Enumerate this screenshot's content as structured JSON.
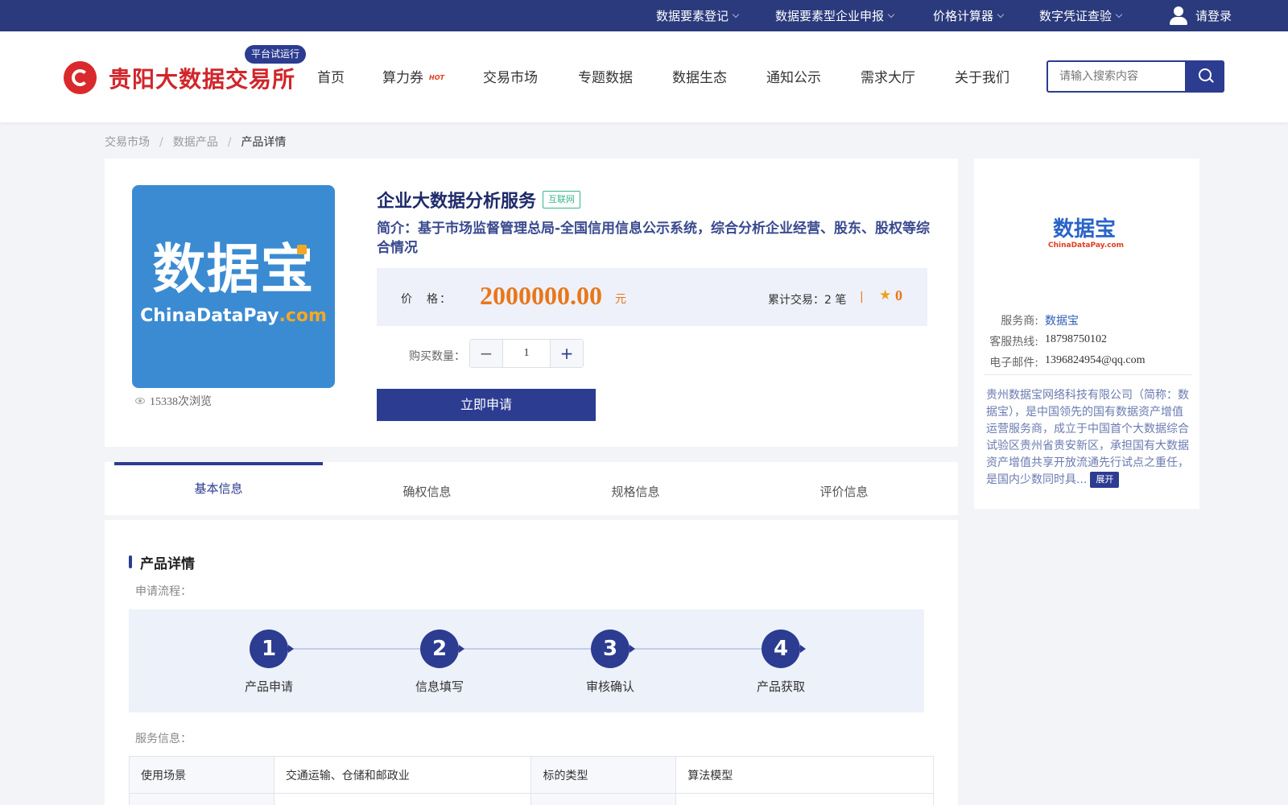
{
  "topbar": {
    "links": [
      "数据要素登记",
      "数据要素型企业申报",
      "价格计算器",
      "数字凭证查验"
    ],
    "login": "请登录"
  },
  "header": {
    "logo_text": "贵阳大数据交易所",
    "beta_badge": "平台试运行",
    "nav": [
      "首页",
      "算力券",
      "交易市场",
      "专题数据",
      "数据生态",
      "通知公示",
      "需求大厅",
      "关于我们"
    ],
    "hot_badge": "HOT",
    "search_placeholder": "请输入搜索内容"
  },
  "breadcrumb": [
    "交易市场",
    "数据产品",
    "产品详情"
  ],
  "product": {
    "image_main_text": "数据宝",
    "image_sub_text_a": "ChinaDataPay",
    "image_sub_text_b": ".com",
    "views": "15338次浏览",
    "title": "企业大数据分析服务",
    "tag": "互联网",
    "intro": "简介：基于市场监督管理总局-全国信用信息公示系统，综合分析企业经营、股东、股权等综合情况",
    "price_label": "价　格：",
    "price": "2000000.00",
    "price_unit": "元",
    "deals": "累计交易：2 笔",
    "divider": "|",
    "rating": "0",
    "qty_label": "购买数量：",
    "qty_minus": "−",
    "qty_value": "1",
    "qty_plus": "+",
    "apply": "立即申请"
  },
  "seller": {
    "logo_main": "数据宝",
    "logo_sub": "ChinaDataPay.com",
    "provider_label": "服务商:",
    "provider": "数据宝",
    "phone_label": "客服热线:",
    "phone": "18798750102",
    "email_label": "电子邮件:",
    "email": "1396824954@qq.com",
    "desc": "贵州数据宝网络科技有限公司（简称：数据宝），是中国领先的国有数据资产增值运营服务商，成立于中国首个大数据综合试验区贵州省贵安新区，承担国有大数据资产增值共享开放流通先行试点之重任，是国内少数同时具...",
    "expand": "展开"
  },
  "tabs": [
    "基本信息",
    "确权信息",
    "规格信息",
    "评价信息"
  ],
  "detail": {
    "section_title": "产品详情",
    "flow_label": "申请流程：",
    "steps": [
      {
        "num": "1",
        "label": "产品申请"
      },
      {
        "num": "2",
        "label": "信息填写"
      },
      {
        "num": "3",
        "label": "审核确认"
      },
      {
        "num": "4",
        "label": "产品获取"
      }
    ],
    "service_label": "服务信息：",
    "table": [
      {
        "k1": "使用场景",
        "v1": "交通运输、仓储和邮政业",
        "k2": "标的类型",
        "v2": "算法模型"
      }
    ]
  }
}
